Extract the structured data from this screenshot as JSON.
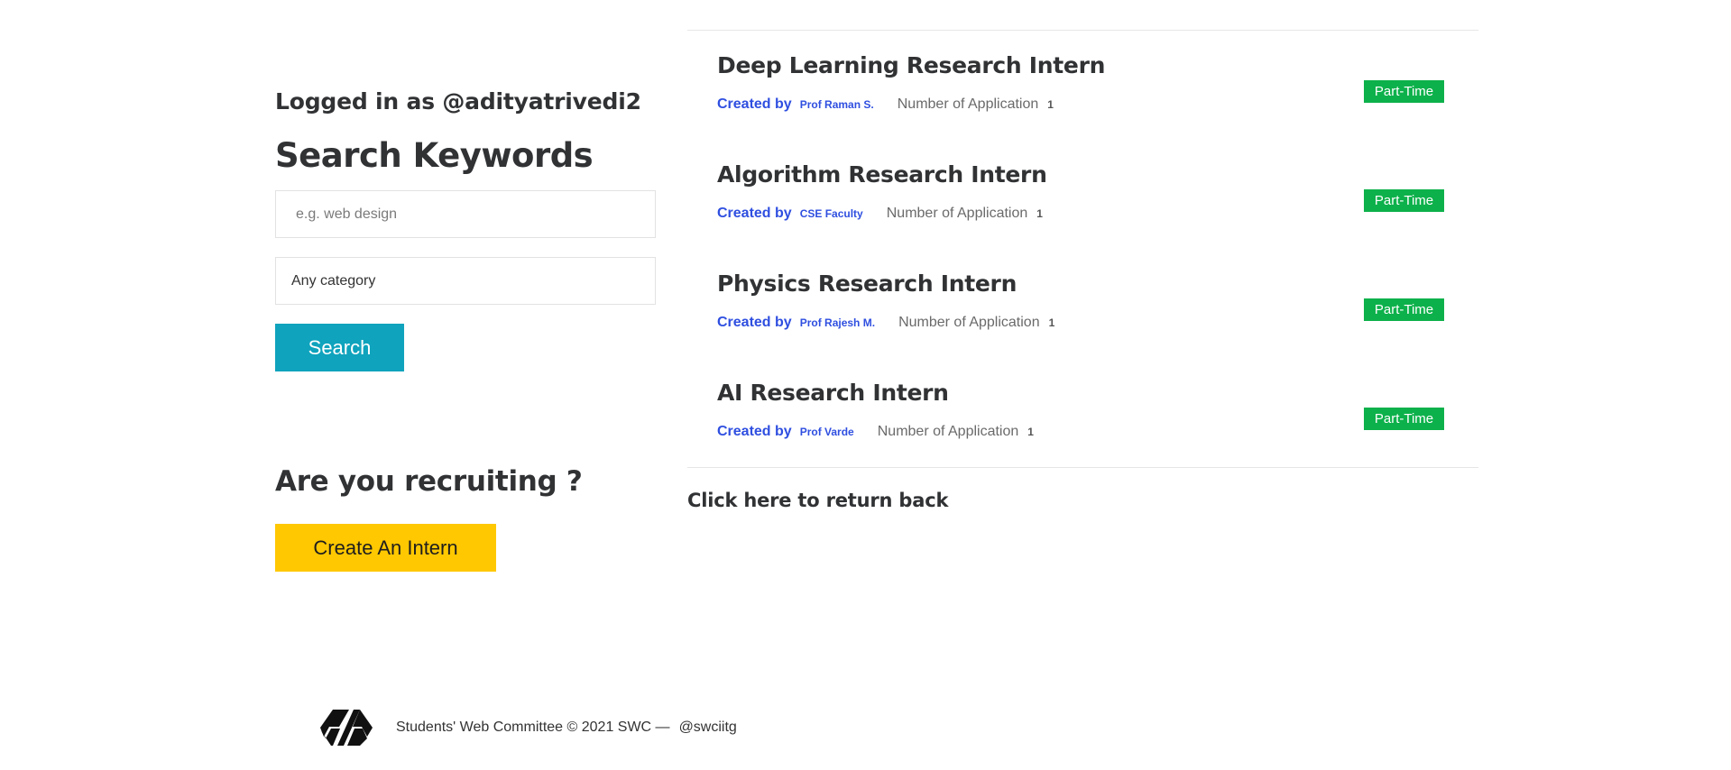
{
  "user": {
    "logged_in_text": "Logged in as @adityatrivedi2"
  },
  "search": {
    "title": "Search Keywords",
    "keyword_placeholder": "e.g. web design",
    "keyword_value": "",
    "category_selected": "Any category",
    "button_label": "Search"
  },
  "recruit": {
    "title": "Are you recruiting ?",
    "button_label": "Create An Intern"
  },
  "jobs": [
    {
      "title": "Deep Learning Research Intern",
      "created_by_label": "Created by",
      "creator": "Prof Raman S.",
      "applications_label": "Number of Application",
      "applications_count": "1",
      "type": "Part-Time"
    },
    {
      "title": "Algorithm Research Intern",
      "created_by_label": "Created by",
      "creator": "CSE Faculty",
      "applications_label": "Number of Application",
      "applications_count": "1",
      "type": "Part-Time"
    },
    {
      "title": "Physics Research Intern",
      "created_by_label": "Created by",
      "creator": "Prof Rajesh M.",
      "applications_label": "Number of Application",
      "applications_count": "1",
      "type": "Part-Time"
    },
    {
      "title": "AI Research Intern",
      "created_by_label": "Created by",
      "creator": "Prof Varde",
      "applications_label": "Number of Application",
      "applications_count": "1",
      "type": "Part-Time"
    }
  ],
  "return_link": "Click here to return back",
  "footer": {
    "logo_icon": "swc-logo-icon",
    "text": "Students' Web Committee © 2021 SWC —",
    "handle": "@swciitg"
  },
  "colors": {
    "search_button": "#0fa3bd",
    "create_button": "#ffc800",
    "badge": "#0db14b",
    "link_blue": "#2f4fe0"
  }
}
